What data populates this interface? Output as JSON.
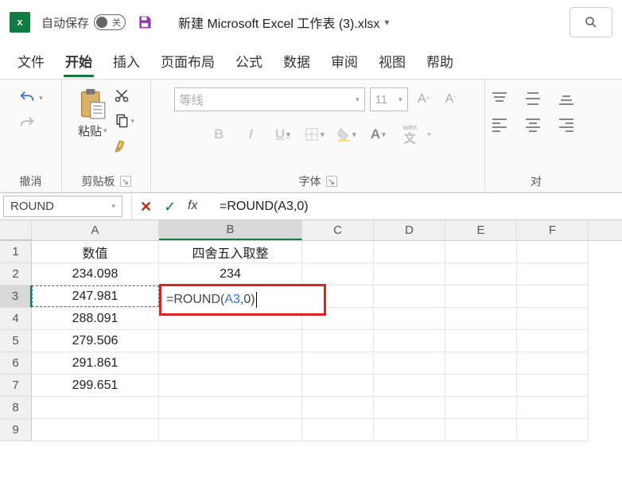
{
  "titlebar": {
    "autosave_label": "自动保存",
    "autosave_off": "关",
    "filename": "新建 Microsoft Excel 工作表 (3).xlsx"
  },
  "tabs": {
    "file": "文件",
    "home": "开始",
    "insert": "插入",
    "layout": "页面布局",
    "formulas": "公式",
    "data": "数据",
    "review": "审阅",
    "view": "视图",
    "help": "帮助"
  },
  "ribbon": {
    "undo_group": "撤消",
    "clipboard_group": "剪贴板",
    "paste": "粘贴",
    "font_group": "字体",
    "font_name": "等线",
    "font_size": "11",
    "wen": "wén",
    "align_label": "对"
  },
  "namebox": "ROUND",
  "formula": "=ROUND(A3,0)",
  "edit_prefix": "=ROUND(",
  "edit_ref": "A3",
  "edit_suffix": ",0)",
  "columns": [
    "A",
    "B",
    "C",
    "D",
    "E",
    "F"
  ],
  "row_numbers": [
    "1",
    "2",
    "3",
    "4",
    "5",
    "6",
    "7",
    "8",
    "9"
  ],
  "sheet": {
    "A1": "数值",
    "B1": "四舍五入取整",
    "A2": "234.098",
    "B2": "234",
    "A3": "247.981",
    "A4": "288.091",
    "A5": "279.506",
    "A6": "291.861",
    "A7": "299.651"
  }
}
